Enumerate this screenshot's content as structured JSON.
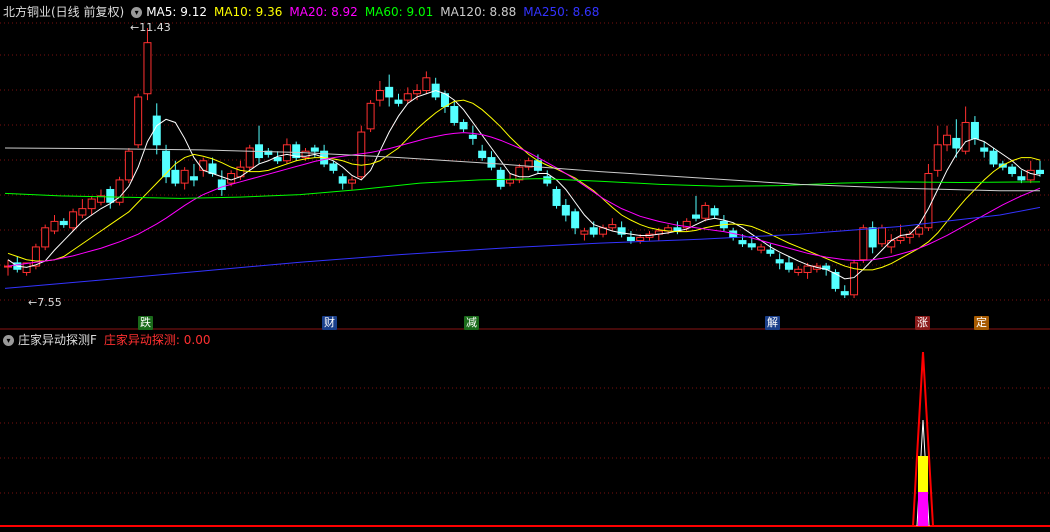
{
  "header": {
    "stock": "北方铜业(日线 前复权)",
    "ma": [
      {
        "label": "MA5: 9.12",
        "color": "#ffffff"
      },
      {
        "label": "MA10: 9.36",
        "color": "#ffff00"
      },
      {
        "label": "MA20: 8.92",
        "color": "#ff00ff"
      },
      {
        "label": "MA60: 9.01",
        "color": "#00ff00"
      },
      {
        "label": "MA120: 8.88",
        "color": "#cccccc"
      },
      {
        "label": "MA250: 8.68",
        "color": "#3333ff"
      }
    ]
  },
  "price_labels": {
    "high": "11.43",
    "low": "7.55"
  },
  "events": [
    {
      "text": "跌",
      "bg": "#1a6b1a",
      "fg": "#ffffff"
    },
    {
      "text": "财",
      "bg": "#1a3f8a",
      "fg": "#ffffff"
    },
    {
      "text": "减",
      "bg": "#1a6b1a",
      "fg": "#ffffff"
    },
    {
      "text": "解",
      "bg": "#1a3f8a",
      "fg": "#ffffff"
    },
    {
      "text": "涨",
      "bg": "#8a1a1a",
      "fg": "#ffffff"
    },
    {
      "text": "定",
      "bg": "#a65a00",
      "fg": "#ffffff"
    }
  ],
  "indicator": {
    "name": "庄家异动探测F",
    "value_label": "庄家异动探测: 0.00"
  },
  "colors": {
    "up": "#ff3030",
    "down": "#54ffff",
    "grid": "#7a1010",
    "ma5": "#ffffff",
    "ma10": "#ffff00",
    "ma20": "#ff00ff",
    "ma60": "#00ff00",
    "ma120": "#cccccc",
    "ma250": "#3333ff",
    "spike": "#ff0000",
    "bar_yellow": "#ffff00",
    "bar_magenta": "#ff00ff"
  },
  "chart_data": {
    "type": "candlestick",
    "candles": [
      [
        7.7,
        7.8,
        7.55,
        7.7
      ],
      [
        7.75,
        7.85,
        7.6,
        7.65
      ],
      [
        7.6,
        7.7,
        7.55,
        7.75
      ],
      [
        7.7,
        8.05,
        7.65,
        8.0
      ],
      [
        8.0,
        8.35,
        7.95,
        8.3
      ],
      [
        8.25,
        8.5,
        8.2,
        8.4
      ],
      [
        8.4,
        8.45,
        8.3,
        8.35
      ],
      [
        8.3,
        8.6,
        8.25,
        8.55
      ],
      [
        8.5,
        8.75,
        8.45,
        8.6
      ],
      [
        8.6,
        8.8,
        8.5,
        8.75
      ],
      [
        8.7,
        8.9,
        8.65,
        8.8
      ],
      [
        8.9,
        8.95,
        8.6,
        8.7
      ],
      [
        8.7,
        9.1,
        8.65,
        9.05
      ],
      [
        9.05,
        9.55,
        9.0,
        9.5
      ],
      [
        9.6,
        10.4,
        9.55,
        10.35
      ],
      [
        10.4,
        11.43,
        10.3,
        11.2
      ],
      [
        10.05,
        10.25,
        9.45,
        9.6
      ],
      [
        9.5,
        9.6,
        9.0,
        9.1
      ],
      [
        9.2,
        9.35,
        8.95,
        9.0
      ],
      [
        9.0,
        9.25,
        8.9,
        9.2
      ],
      [
        9.1,
        9.3,
        8.95,
        9.05
      ],
      [
        9.2,
        9.4,
        9.1,
        9.35
      ],
      [
        9.3,
        9.4,
        9.1,
        9.15
      ],
      [
        9.05,
        9.2,
        8.8,
        8.9
      ],
      [
        9.0,
        9.2,
        8.95,
        9.15
      ],
      [
        9.1,
        9.35,
        9.05,
        9.25
      ],
      [
        9.25,
        9.6,
        9.2,
        9.55
      ],
      [
        9.6,
        9.9,
        9.3,
        9.4
      ],
      [
        9.5,
        9.55,
        9.4,
        9.45
      ],
      [
        9.4,
        9.5,
        9.3,
        9.35
      ],
      [
        9.35,
        9.7,
        9.3,
        9.6
      ],
      [
        9.6,
        9.65,
        9.35,
        9.4
      ],
      [
        9.4,
        9.55,
        9.35,
        9.5
      ],
      [
        9.55,
        9.6,
        9.4,
        9.5
      ],
      [
        9.5,
        9.6,
        9.25,
        9.3
      ],
      [
        9.3,
        9.35,
        9.15,
        9.2
      ],
      [
        9.1,
        9.15,
        8.9,
        9.0
      ],
      [
        9.0,
        9.1,
        8.9,
        9.05
      ],
      [
        9.1,
        9.9,
        9.05,
        9.8
      ],
      [
        9.85,
        10.3,
        9.8,
        10.25
      ],
      [
        10.3,
        10.6,
        10.2,
        10.45
      ],
      [
        10.5,
        10.7,
        10.2,
        10.35
      ],
      [
        10.3,
        10.4,
        10.2,
        10.25
      ],
      [
        10.3,
        10.5,
        10.25,
        10.4
      ],
      [
        10.4,
        10.55,
        10.3,
        10.45
      ],
      [
        10.45,
        10.75,
        10.4,
        10.65
      ],
      [
        10.55,
        10.65,
        10.3,
        10.35
      ],
      [
        10.4,
        10.45,
        10.1,
        10.2
      ],
      [
        10.2,
        10.3,
        9.9,
        9.95
      ],
      [
        9.95,
        10.0,
        9.8,
        9.85
      ],
      [
        9.75,
        9.9,
        9.6,
        9.7
      ],
      [
        9.5,
        9.6,
        9.35,
        9.4
      ],
      [
        9.4,
        9.5,
        9.2,
        9.25
      ],
      [
        9.2,
        9.25,
        8.9,
        8.95
      ],
      [
        9.0,
        9.15,
        8.95,
        9.05
      ],
      [
        9.05,
        9.3,
        9.0,
        9.25
      ],
      [
        9.25,
        9.4,
        9.2,
        9.35
      ],
      [
        9.35,
        9.45,
        9.15,
        9.2
      ],
      [
        9.1,
        9.2,
        8.95,
        9.0
      ],
      [
        8.9,
        8.95,
        8.6,
        8.65
      ],
      [
        8.65,
        8.75,
        8.4,
        8.5
      ],
      [
        8.55,
        8.6,
        8.2,
        8.3
      ],
      [
        8.2,
        8.3,
        8.1,
        8.25
      ],
      [
        8.3,
        8.4,
        8.15,
        8.2
      ],
      [
        8.2,
        8.35,
        8.15,
        8.3
      ],
      [
        8.3,
        8.45,
        8.25,
        8.35
      ],
      [
        8.3,
        8.4,
        8.15,
        8.2
      ],
      [
        8.15,
        8.25,
        8.05,
        8.1
      ],
      [
        8.1,
        8.2,
        8.05,
        8.15
      ],
      [
        8.15,
        8.25,
        8.1,
        8.2
      ],
      [
        8.2,
        8.3,
        8.1,
        8.25
      ],
      [
        8.25,
        8.35,
        8.2,
        8.3
      ],
      [
        8.3,
        8.4,
        8.2,
        8.25
      ],
      [
        8.3,
        8.45,
        8.25,
        8.4
      ],
      [
        8.5,
        8.8,
        8.4,
        8.45
      ],
      [
        8.45,
        8.7,
        8.4,
        8.65
      ],
      [
        8.6,
        8.65,
        8.45,
        8.5
      ],
      [
        8.4,
        8.5,
        8.25,
        8.3
      ],
      [
        8.25,
        8.3,
        8.1,
        8.15
      ],
      [
        8.1,
        8.2,
        8.0,
        8.05
      ],
      [
        8.05,
        8.15,
        7.95,
        8.0
      ],
      [
        7.95,
        8.05,
        7.9,
        8.0
      ],
      [
        7.95,
        8.05,
        7.85,
        7.9
      ],
      [
        7.8,
        7.9,
        7.65,
        7.75
      ],
      [
        7.75,
        7.85,
        7.6,
        7.65
      ],
      [
        7.6,
        7.7,
        7.55,
        7.65
      ],
      [
        7.6,
        7.75,
        7.5,
        7.7
      ],
      [
        7.65,
        7.75,
        7.6,
        7.7
      ],
      [
        7.7,
        7.75,
        7.55,
        7.65
      ],
      [
        7.6,
        7.65,
        7.3,
        7.35
      ],
      [
        7.3,
        7.4,
        7.2,
        7.25
      ],
      [
        7.25,
        7.8,
        7.2,
        7.75
      ],
      [
        7.8,
        8.35,
        7.75,
        8.3
      ],
      [
        8.3,
        8.4,
        7.9,
        8.0
      ],
      [
        8.05,
        8.35,
        8.0,
        8.3
      ],
      [
        8.0,
        8.2,
        7.9,
        8.1
      ],
      [
        8.1,
        8.35,
        8.05,
        8.15
      ],
      [
        8.15,
        8.25,
        8.05,
        8.2
      ],
      [
        8.2,
        8.35,
        8.15,
        8.3
      ],
      [
        8.3,
        9.3,
        8.25,
        9.15
      ],
      [
        9.2,
        9.9,
        9.1,
        9.6
      ],
      [
        9.6,
        9.9,
        9.5,
        9.75
      ],
      [
        9.7,
        10.0,
        9.4,
        9.55
      ],
      [
        9.5,
        10.2,
        9.45,
        9.95
      ],
      [
        9.95,
        10.05,
        9.6,
        9.7
      ],
      [
        9.55,
        9.65,
        9.4,
        9.5
      ],
      [
        9.5,
        9.55,
        9.25,
        9.3
      ],
      [
        9.3,
        9.35,
        9.2,
        9.25
      ],
      [
        9.25,
        9.3,
        9.1,
        9.15
      ],
      [
        9.1,
        9.2,
        9.0,
        9.05
      ],
      [
        9.05,
        9.35,
        9.0,
        9.2
      ],
      [
        9.2,
        9.35,
        9.1,
        9.15
      ]
    ],
    "ma5": [
      7.8,
      7.7,
      7.68,
      7.72,
      7.78,
      7.95,
      8.1,
      8.25,
      8.4,
      8.5,
      8.6,
      8.68,
      8.78,
      8.95,
      9.25,
      9.65,
      9.9,
      10.0,
      9.95,
      9.7,
      9.4,
      9.2,
      9.15,
      9.1,
      9.05,
      9.1,
      9.2,
      9.3,
      9.35,
      9.42,
      9.45,
      9.42,
      9.42,
      9.45,
      9.4,
      9.35,
      9.25,
      9.12,
      9.05,
      9.2,
      9.5,
      9.8,
      10.05,
      10.25,
      10.35,
      10.4,
      10.45,
      10.4,
      10.3,
      10.15,
      9.95,
      9.75,
      9.55,
      9.35,
      9.15,
      9.1,
      9.1,
      9.15,
      9.15,
      9.05,
      8.9,
      8.7,
      8.5,
      8.35,
      8.3,
      8.25,
      8.22,
      8.2,
      8.18,
      8.18,
      8.2,
      8.22,
      8.25,
      8.28,
      8.35,
      8.42,
      8.45,
      8.42,
      8.38,
      8.3,
      8.2,
      8.1,
      8.0,
      7.92,
      7.85,
      7.78,
      7.72,
      7.68,
      7.65,
      7.58,
      7.5,
      7.52,
      7.65,
      7.8,
      7.95,
      8.1,
      8.18,
      8.2,
      8.35,
      8.6,
      8.9,
      9.2,
      9.45,
      9.65,
      9.7,
      9.65,
      9.55,
      9.45,
      9.35,
      9.22,
      9.15,
      9.12
    ],
    "ma10": [
      7.9,
      7.85,
      7.8,
      7.78,
      7.78,
      7.8,
      7.85,
      7.95,
      8.05,
      8.15,
      8.25,
      8.35,
      8.45,
      8.55,
      8.7,
      8.85,
      9.0,
      9.15,
      9.3,
      9.4,
      9.45,
      9.42,
      9.38,
      9.32,
      9.25,
      9.2,
      9.18,
      9.18,
      9.2,
      9.25,
      9.3,
      9.35,
      9.38,
      9.4,
      9.4,
      9.38,
      9.35,
      9.3,
      9.28,
      9.3,
      9.35,
      9.45,
      9.55,
      9.7,
      9.85,
      9.98,
      10.1,
      10.2,
      10.28,
      10.3,
      10.25,
      10.15,
      10.02,
      9.88,
      9.72,
      9.58,
      9.45,
      9.35,
      9.28,
      9.22,
      9.15,
      9.08,
      8.98,
      8.88,
      8.75,
      8.62,
      8.5,
      8.42,
      8.35,
      8.3,
      8.27,
      8.25,
      8.24,
      8.24,
      8.26,
      8.3,
      8.33,
      8.35,
      8.36,
      8.35,
      8.32,
      8.26,
      8.2,
      8.13,
      8.06,
      8.0,
      7.94,
      7.88,
      7.82,
      7.76,
      7.7,
      7.66,
      7.64,
      7.64,
      7.68,
      7.74,
      7.82,
      7.9,
      7.98,
      8.08,
      8.22,
      8.4,
      8.58,
      8.75,
      8.9,
      9.05,
      9.18,
      9.28,
      9.35,
      9.4,
      9.4,
      9.36
    ],
    "ma20": [
      7.7,
      7.72,
      7.74,
      7.76,
      7.78,
      7.8,
      7.83,
      7.86,
      7.9,
      7.94,
      7.98,
      8.03,
      8.08,
      8.14,
      8.2,
      8.28,
      8.36,
      8.45,
      8.55,
      8.65,
      8.74,
      8.82,
      8.88,
      8.94,
      8.98,
      9.02,
      9.06,
      9.1,
      9.14,
      9.18,
      9.22,
      9.26,
      9.3,
      9.34,
      9.37,
      9.4,
      9.42,
      9.44,
      9.46,
      9.48,
      9.51,
      9.54,
      9.58,
      9.62,
      9.66,
      9.7,
      9.73,
      9.76,
      9.78,
      9.79,
      9.78,
      9.76,
      9.72,
      9.67,
      9.61,
      9.55,
      9.48,
      9.4,
      9.32,
      9.24,
      9.15,
      9.06,
      8.96,
      8.86,
      8.76,
      8.68,
      8.6,
      8.54,
      8.48,
      8.44,
      8.4,
      8.37,
      8.34,
      8.32,
      8.3,
      8.28,
      8.26,
      8.24,
      8.21,
      8.18,
      8.14,
      8.1,
      8.06,
      8.02,
      7.98,
      7.94,
      7.9,
      7.87,
      7.84,
      7.82,
      7.8,
      7.79,
      7.79,
      7.8,
      7.82,
      7.85,
      7.89,
      7.93,
      7.98,
      8.04,
      8.11,
      8.18,
      8.26,
      8.34,
      8.42,
      8.5,
      8.58,
      8.66,
      8.73,
      8.8,
      8.86,
      8.92
    ]
  },
  "indicator_data": {
    "values": [
      0,
      0,
      0,
      0,
      0,
      0,
      0,
      0,
      0,
      0,
      0,
      0,
      0,
      0,
      0,
      0,
      0,
      0,
      0,
      0,
      0,
      0,
      0,
      0,
      0,
      0,
      0,
      0,
      0,
      0,
      0,
      0,
      0,
      0,
      0,
      0,
      0,
      0,
      0,
      0,
      0,
      0,
      0,
      0,
      0,
      0,
      0,
      0,
      0,
      0,
      0,
      0,
      0,
      0,
      0,
      0,
      0,
      0,
      0,
      0,
      0,
      0,
      0,
      0,
      0,
      0,
      0,
      0,
      0,
      0,
      0,
      0,
      0,
      0,
      0,
      0,
      0,
      0,
      0,
      0,
      0,
      0,
      0,
      0,
      0,
      0,
      0,
      0,
      0,
      0,
      0,
      0,
      0,
      0,
      0,
      0,
      0,
      0,
      0,
      0,
      0,
      0,
      0,
      0,
      0,
      0,
      0,
      0,
      0,
      0,
      0,
      0
    ]
  }
}
